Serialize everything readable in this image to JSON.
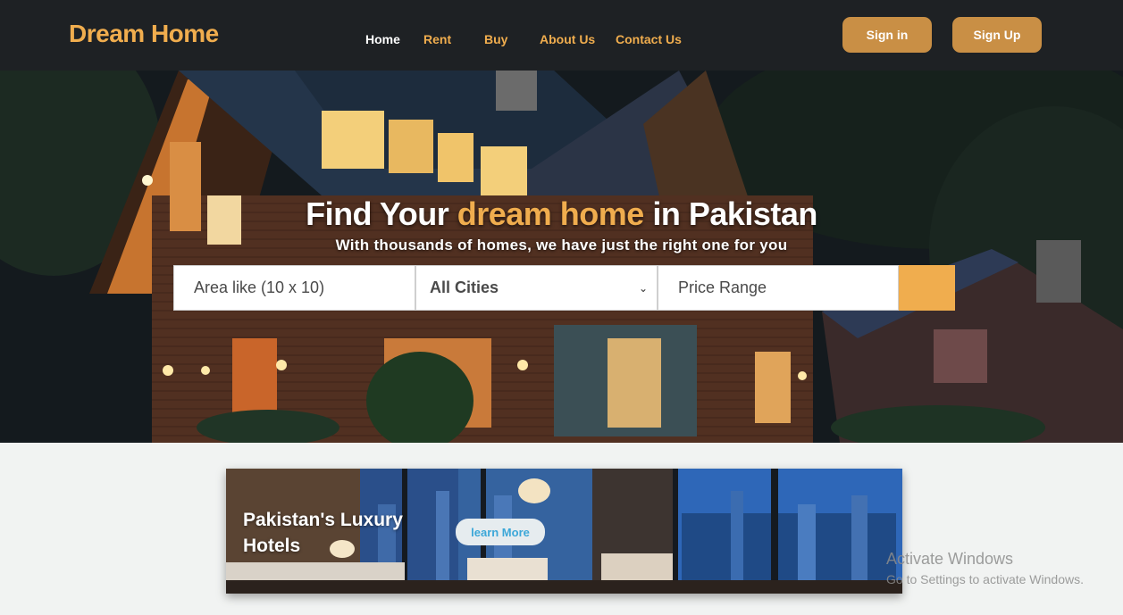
{
  "brand": "Dream Home",
  "nav": {
    "home": "Home",
    "rent": "Rent",
    "buy": "Buy",
    "about": "About Us",
    "contact": "Contact Us"
  },
  "auth": {
    "signin": "Sign in",
    "signup": "Sign Up"
  },
  "hero": {
    "title_prefix": "Find Your",
    "title_accent": "dream home",
    "title_suffix": "in Pakistan",
    "subtitle": "With thousands of homes, we have just the right one for you"
  },
  "search": {
    "area_placeholder": "Area like (10 x 10)",
    "city_selected": "All Cities",
    "price_placeholder": "Price Range"
  },
  "promo": {
    "title": "Pakistan's Luxury Hotels",
    "button": "learn More"
  },
  "watermark": {
    "title": "Activate Windows",
    "subtitle": "Go to Settings to activate Windows."
  },
  "colors": {
    "accent": "#f0ad4e",
    "navbar": "#1e2124",
    "auth_button": "#c98f45",
    "learn_text": "#3ca7d8"
  }
}
